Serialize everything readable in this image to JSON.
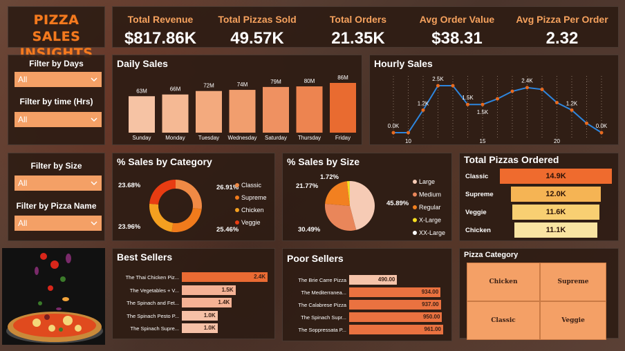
{
  "title": {
    "line1": "PIZZA SALES",
    "line2": "INSIGHTS"
  },
  "kpis": [
    {
      "label": "Total Revenue",
      "value": "$817.86K"
    },
    {
      "label": "Total Pizzas Sold",
      "value": "49.57K"
    },
    {
      "label": "Total Orders",
      "value": "21.35K"
    },
    {
      "label": "Avg Order Value",
      "value": "$38.31"
    },
    {
      "label": "Avg Pizza Per Order",
      "value": "2.32"
    }
  ],
  "filters": {
    "days": {
      "label": "Filter by Days",
      "value": "All"
    },
    "time": {
      "label": "Filter by time (Hrs)",
      "value": "All"
    },
    "size": {
      "label": "Filter by Size",
      "value": "All"
    },
    "name": {
      "label": "Filter by Pizza Name",
      "value": "All"
    }
  },
  "daily_sales": {
    "title": "Daily Sales",
    "chart_data": {
      "type": "bar",
      "categories": [
        "Sunday",
        "Monday",
        "Tuesday",
        "Wednesday",
        "Saturday",
        "Thursday",
        "Friday"
      ],
      "values": [
        63,
        66,
        72,
        74,
        79,
        80,
        86
      ],
      "labels": [
        "63M",
        "66M",
        "72M",
        "74M",
        "79M",
        "80M",
        "86M"
      ],
      "colors": [
        "#f6c3a4",
        "#f5b994",
        "#f3aa7e",
        "#f19e6e",
        "#ef9161",
        "#ed8450",
        "#e96b30"
      ]
    }
  },
  "hourly_sales": {
    "title": "Hourly Sales",
    "chart_data": {
      "type": "line",
      "x": [
        9,
        10,
        11,
        12,
        13,
        14,
        15,
        16,
        17,
        18,
        19,
        20,
        21,
        22,
        23
      ],
      "y": [
        0.0,
        0.0,
        1.2,
        2.5,
        2.5,
        1.5,
        1.5,
        1.8,
        2.2,
        2.4,
        2.3,
        1.6,
        1.2,
        0.5,
        0.0
      ],
      "labels": [
        {
          "x": 9,
          "text": "0.0K"
        },
        {
          "x": 11,
          "text": "1.2K"
        },
        {
          "x": 12,
          "text": "2.5K"
        },
        {
          "x": 14,
          "text": "1.5K"
        },
        {
          "x": 15,
          "text": "1.5K"
        },
        {
          "x": 18,
          "text": "2.4K"
        },
        {
          "x": 21,
          "text": "1.2K"
        },
        {
          "x": 23,
          "text": "0.0K"
        }
      ],
      "ticks": [
        "10",
        "15",
        "20"
      ],
      "tick_values": [
        10,
        15,
        20
      ],
      "line_color": "#2e86de",
      "marker_color": "#e86a1f"
    }
  },
  "sales_by_category": {
    "title": "% Sales by Category",
    "chart_data": {
      "type": "pie",
      "donut": true,
      "labels": [
        "Classic",
        "Supreme",
        "Chicken",
        "Veggie"
      ],
      "values": [
        26.91,
        25.46,
        23.96,
        23.68
      ],
      "texts": [
        "26.91%",
        "25.46%",
        "23.96%",
        "23.68%"
      ],
      "colors": [
        "#f08a45",
        "#f07b1c",
        "#f4a020",
        "#e83c12"
      ]
    }
  },
  "sales_by_size": {
    "title": "% Sales by Size",
    "chart_data": {
      "type": "pie",
      "labels": [
        "Large",
        "Medium",
        "Regular",
        "X-Large",
        "XX-Large"
      ],
      "values": [
        45.89,
        30.49,
        21.77,
        1.72,
        0.12
      ],
      "texts": [
        "45.89%",
        "30.49%",
        "21.77%",
        "1.72%"
      ],
      "colors": [
        "#f6cbb5",
        "#e9865a",
        "#f28020",
        "#f8e020",
        "#ffffff"
      ]
    }
  },
  "total_pizzas": {
    "title": "Total Pizzas Ordered",
    "chart_data": {
      "type": "bar",
      "categories": [
        "Classic",
        "Supreme",
        "Veggie",
        "Chicken"
      ],
      "values": [
        14.9,
        12.0,
        11.6,
        11.1
      ],
      "texts": [
        "14.9K",
        "12.0K",
        "11.6K",
        "11.1K"
      ],
      "colors": [
        "#ef6b2e",
        "#f5b454",
        "#f8cf72",
        "#f9e4a2"
      ]
    }
  },
  "best_sellers": {
    "title": "Best Sellers",
    "chart_data": {
      "type": "bar",
      "categories": [
        "The Thai Chicken Piz...",
        "The Vegetables + V...",
        "The Spinach and Fet...",
        "The Spinach Pesto P...",
        "The Spinach Supre..."
      ],
      "values": [
        2.4,
        1.5,
        1.4,
        1.0,
        1.0
      ],
      "texts": [
        "2.4K",
        "1.5K",
        "1.4K",
        "1.0K",
        "1.0K"
      ],
      "colors": [
        "#ea6b33",
        "#f5b295",
        "#f5b295",
        "#f6c1a7",
        "#f6c1a7"
      ]
    }
  },
  "poor_sellers": {
    "title": "Poor Sellers",
    "chart_data": {
      "type": "bar",
      "categories": [
        "The Brie Carre Pizza",
        "The Mediterranea...",
        "The Calabrese Pizza",
        "The Spinach Supr...",
        "The Soppressata P..."
      ],
      "values": [
        490,
        934,
        937,
        950,
        961
      ],
      "texts": [
        "490.00",
        "934.00",
        "937.00",
        "950.00",
        "961.00"
      ],
      "colors": [
        "#f6c4aa",
        "#ea7240",
        "#ea7240",
        "#ea7240",
        "#ea7240"
      ]
    }
  },
  "pizza_category": {
    "title": "Pizza Category",
    "items": [
      "Chicken",
      "Supreme",
      "Classic",
      "Veggie"
    ]
  }
}
